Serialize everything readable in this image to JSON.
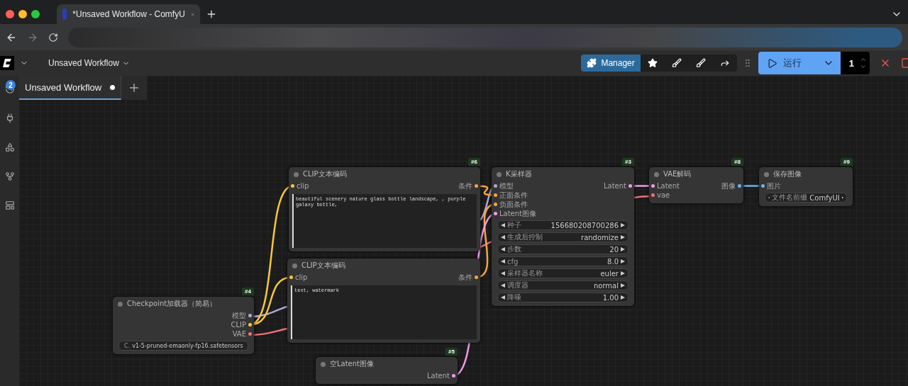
{
  "browser": {
    "tab_title": "*Unsaved Workflow - ComfyU"
  },
  "topbar": {
    "workflow_menu": "Unsaved Workflow",
    "manager_button": "Manager",
    "run_button": "运行",
    "batch_count": "1"
  },
  "sidebar": {
    "queue_badge": "2"
  },
  "workflow_tabs": [
    {
      "label": "Unsaved Workflow",
      "selected": true,
      "unsaved": true
    }
  ],
  "nodes": [
    {
      "badge": "#6",
      "title": "CLIP文本编码",
      "inputs": [
        {
          "label": "clip",
          "color": "#f5c83b"
        }
      ],
      "outputs": [
        {
          "label": "条件",
          "color": "#f4a640"
        }
      ],
      "text": "beautiful scenery nature glass bottle landscape, , purple galaxy bottle,"
    },
    {
      "badge": "#3",
      "title": "K采样器",
      "inputs": [
        {
          "label": "模型",
          "color": "#b2a4d8"
        },
        {
          "label": "正面条件",
          "color": "#f4a640"
        },
        {
          "label": "负面条件",
          "color": "#f4a640"
        },
        {
          "label": "Latent图像",
          "color": "#f29be6"
        }
      ],
      "outputs": [
        {
          "label": "Latent",
          "color": "#f29be6"
        }
      ],
      "widgets": [
        {
          "label": "种子",
          "value": "156680208700286"
        },
        {
          "label": "生成后控制",
          "value": "randomize"
        },
        {
          "label": "步数",
          "value": "20"
        },
        {
          "label": "cfg",
          "value": "8.0"
        },
        {
          "label": "采样器名称",
          "value": "euler"
        },
        {
          "label": "调度器",
          "value": "normal"
        },
        {
          "label": "降噪",
          "value": "1.00"
        }
      ]
    },
    {
      "badge": "#8",
      "title": "VAE解码",
      "inputs": [
        {
          "label": "Latent",
          "color": "#f29be6"
        },
        {
          "label": "vae",
          "color": "#f0727a"
        }
      ],
      "outputs": [
        {
          "label": "图像",
          "color": "#6eb3f0"
        }
      ]
    },
    {
      "badge": "#9",
      "title": "保存图像",
      "inputs": [
        {
          "label": "图片",
          "color": "#6eb3f0"
        }
      ],
      "widgets": [
        {
          "label": "文件名前缀",
          "value": "ComfyUI"
        }
      ]
    },
    {
      "title": "CLIP文本编码",
      "inputs": [
        {
          "label": "clip",
          "color": "#f5c83b"
        }
      ],
      "outputs": [
        {
          "label": "条件",
          "color": "#f4a640"
        }
      ],
      "text": "text, watermark"
    },
    {
      "badge": "#4",
      "title": "Checkpoint加载器（简易）",
      "outputs": [
        {
          "label": "模型",
          "color": "#b2a4d8"
        },
        {
          "label": "CLIP",
          "color": "#f5c83b"
        },
        {
          "label": "VAE",
          "color": "#f0727a"
        }
      ],
      "widgets": [
        {
          "label": "C.",
          "value": "v1-5-pruned-emaonly-fp16.safetensors"
        }
      ]
    },
    {
      "badge": "#5",
      "title": "空Latent图像",
      "outputs": [
        {
          "label": "Latent",
          "color": "#f29be6"
        }
      ]
    }
  ]
}
